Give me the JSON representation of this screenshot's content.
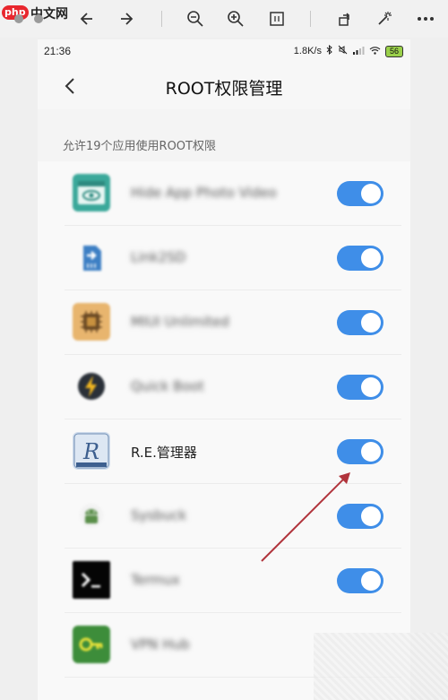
{
  "viewer": {
    "logo_php": "php",
    "logo_cn": "中文网",
    "icons": [
      "back-arrow",
      "forward-arrow",
      "zoom-out",
      "zoom-in",
      "fit-page",
      "rotate",
      "magic-wand",
      "more"
    ]
  },
  "status_bar": {
    "time": "21:36",
    "speed": "1.8K/s",
    "battery": "56"
  },
  "app_bar": {
    "title": "ROOT权限管理"
  },
  "section": {
    "caption": "允许19个应用使用ROOT权限"
  },
  "apps": [
    {
      "name": "Hide App Photo Video",
      "enabled": true,
      "icon": "hide-app-icon",
      "blurred": true
    },
    {
      "name": "Link2SD",
      "enabled": true,
      "icon": "link2sd-icon",
      "blurred": true
    },
    {
      "name": "MIUI Unlimited",
      "enabled": true,
      "icon": "chip-icon",
      "blurred": true
    },
    {
      "name": "Quick Boot",
      "enabled": true,
      "icon": "lightning-icon",
      "blurred": true
    },
    {
      "name": "R.E.管理器",
      "enabled": true,
      "icon": "re-manager-icon",
      "blurred": false
    },
    {
      "name": "Sysbuck",
      "enabled": true,
      "icon": "android-icon",
      "blurred": true
    },
    {
      "name": "Termux",
      "enabled": true,
      "icon": "terminal-icon",
      "blurred": true
    },
    {
      "name": "VPN Hub",
      "enabled": false,
      "icon": "key-icon",
      "blurred": true
    }
  ],
  "colors": {
    "toggle_on": "#3f8ee8",
    "annotation_arrow": "#b1343c"
  }
}
